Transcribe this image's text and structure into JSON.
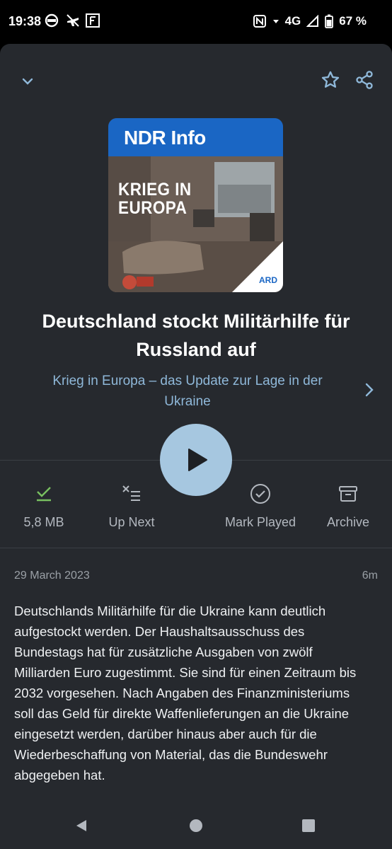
{
  "status_bar": {
    "time": "19:38",
    "network": "4G",
    "battery": "67 %"
  },
  "header": {
    "collapse_icon": "chevron-down-icon",
    "star_icon": "star-icon",
    "share_icon": "share-icon"
  },
  "artwork": {
    "brand": "NDR Info",
    "title_line1": "KRIEG IN",
    "title_line2": "EUROPA",
    "badge": "ARD"
  },
  "episode": {
    "title": "Deutschland stockt Militärhilfe für Russland auf",
    "podcast": "Krieg in Europa – das Update zur Lage in der Ukraine",
    "date": "29 March 2023",
    "duration": "6m",
    "description": "Deutschlands Militärhilfe für die Ukraine kann deutlich aufgestockt werden. Der Haushaltsausschuss des Bundestags hat für zusätzliche Ausgaben von zwölf Milliarden Euro zugestimmt. Sie sind für einen Zeitraum bis 2032 vorgesehen. Nach Angaben des Finanzministeriums soll das Geld für direkte Waffenlieferungen an die Ukraine eingesetzt werden, darüber hinaus aber auch für die Wiederbeschaffung von Material, das die Bundeswehr abgegeben hat."
  },
  "actions": {
    "download_label": "5,8 MB",
    "up_next_label": "Up Next",
    "mark_played_label": "Mark Played",
    "archive_label": "Archive"
  },
  "colors": {
    "sheet_bg": "#26292e",
    "accent": "#8fb8d9",
    "play_button": "#a6c7e0",
    "download_check": "#78c060"
  }
}
